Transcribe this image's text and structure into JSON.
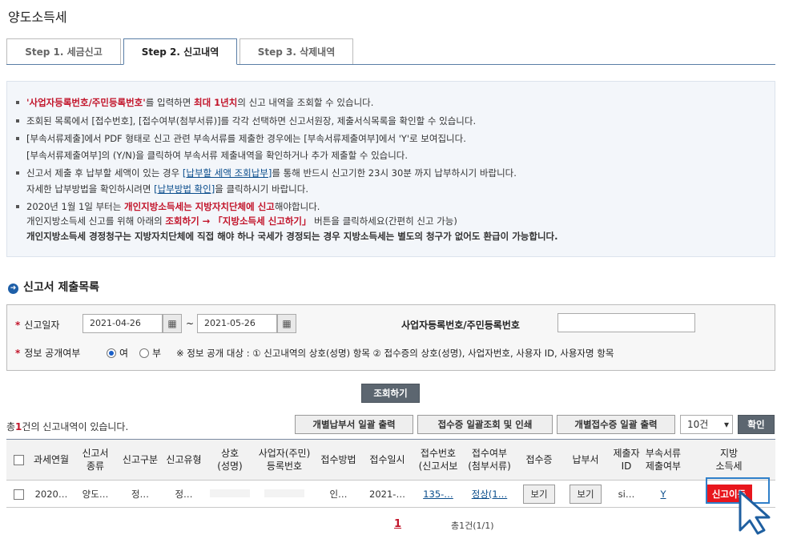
{
  "page": {
    "title": "양도소득세"
  },
  "tabs": [
    "Step 1. 세금신고",
    "Step 2. 신고내역",
    "Step 3. 삭제내역"
  ],
  "info": {
    "l1a": "'사업자등록번호/주민등록번호'",
    "l1b": "를 입력하면 ",
    "l1c": "최대 1년치",
    "l1d": "의 신고 내역을 조회할 수 있습니다.",
    "l2": "조회된 목록에서 [접수번호], [접수여부(첨부서류)]를 각각 선택하면 신고서원장, 제출서식목록을 확인할 수 있습니다.",
    "l3a": "[부속서류제출]에서 PDF 형태로 신고 관련 부속서류를 제출한 경우에는 [부속서류제출여부]에서 'Y'로 보여집니다.",
    "l3b": "[부속서류제출여부]의 (Y/N)을 클릭하여 부속서류 제출내역을 확인하거나 추가 제출할 수 있습니다.",
    "l4a": "신고서 제출 후 납부할 세액이 있는 경우 ",
    "l4link": "[납부할 세액 조회납부]",
    "l4b": "를 통해 반드시 신고기한 23시 30분 까지 납부하시기 바랍니다.",
    "l4c": "자세한 납부방법을 확인하시려면 ",
    "l4link2": "[납부방법 확인]",
    "l4d": "을 클릭하시기 바랍니다.",
    "l5a": "2020년 1월 1일 부터는 ",
    "l5b": "개인지방소득세는 지방자치단체에 신고",
    "l5c": "해야합니다.",
    "l5d": "개인지방소득세 신고를 위해 아래의 ",
    "l5e": "조회하기 → 「지방소득세 신고하기」",
    "l5f": " 버튼을 클릭하세요(간편히 신고 가능)",
    "l5g": "개인지방소득세 경정청구는 지방자치단체에 직접 해야 하나 국세가 경정되는 경우 지방소득세는 별도의 청구가 없어도 환급이 가능합니다."
  },
  "section": {
    "title": "신고서 제출목록",
    "icon": "arrow-circle-icon"
  },
  "search": {
    "date_label": "신고일자",
    "date_from": "2021-04-26",
    "date_to": "2021-05-26",
    "tilde": "~",
    "id_label": "사업자등록번호/주민등록번호",
    "id_value": "",
    "public_label": "정보 공개여부",
    "yes": "여",
    "no": "부",
    "yes_selected": true,
    "note": "※ 정보 공개 대상 : ① 신고내역의 상호(성명) 항목 ② 접수증의 상호(성명), 사업자번호, 사용자 ID, 사용자명 항목",
    "button": "조회하기"
  },
  "results": {
    "count_pre": "총",
    "count_num": "1",
    "count_post": "건의 신고내역이 있습니다.",
    "btn_print_payment": "개별납부서 일괄 출력",
    "btn_receipt": "접수증 일괄조회 및 인쇄",
    "btn_print_receipt": "개별접수증 일괄 출력",
    "page_size": "10건",
    "btn_confirm": "확인"
  },
  "table": {
    "headers": [
      "",
      "과세연월",
      "신고서\n종류",
      "신고구분",
      "신고유형",
      "상호\n(성명)",
      "사업자(주민)\n등록번호",
      "접수방법",
      "접수일시",
      "접수번호\n(신고서보",
      "접수여부\n(첨부서류)",
      "접수증",
      "납부서",
      "제출자\nID",
      "부속서류\n제출여부",
      "지방\n소득세"
    ],
    "row": {
      "ym": "2020…",
      "kind": "양도…",
      "div": "정…",
      "type": "정…",
      "name": "",
      "regno": "",
      "method": "인…",
      "date": "2021-…",
      "recno": "135-…",
      "status": "정상(1…",
      "receipt_btn": "보기",
      "payment_btn": "보기",
      "submitter": "si…",
      "attach": "Y",
      "local_btn": "신고이동"
    }
  },
  "pagination": {
    "current": "1",
    "summary": "총1건(1/1)"
  },
  "colors": {
    "accent_red": "#e8161d",
    "link_blue": "#0a4d8c",
    "tab_border": "#5a7ea6"
  }
}
